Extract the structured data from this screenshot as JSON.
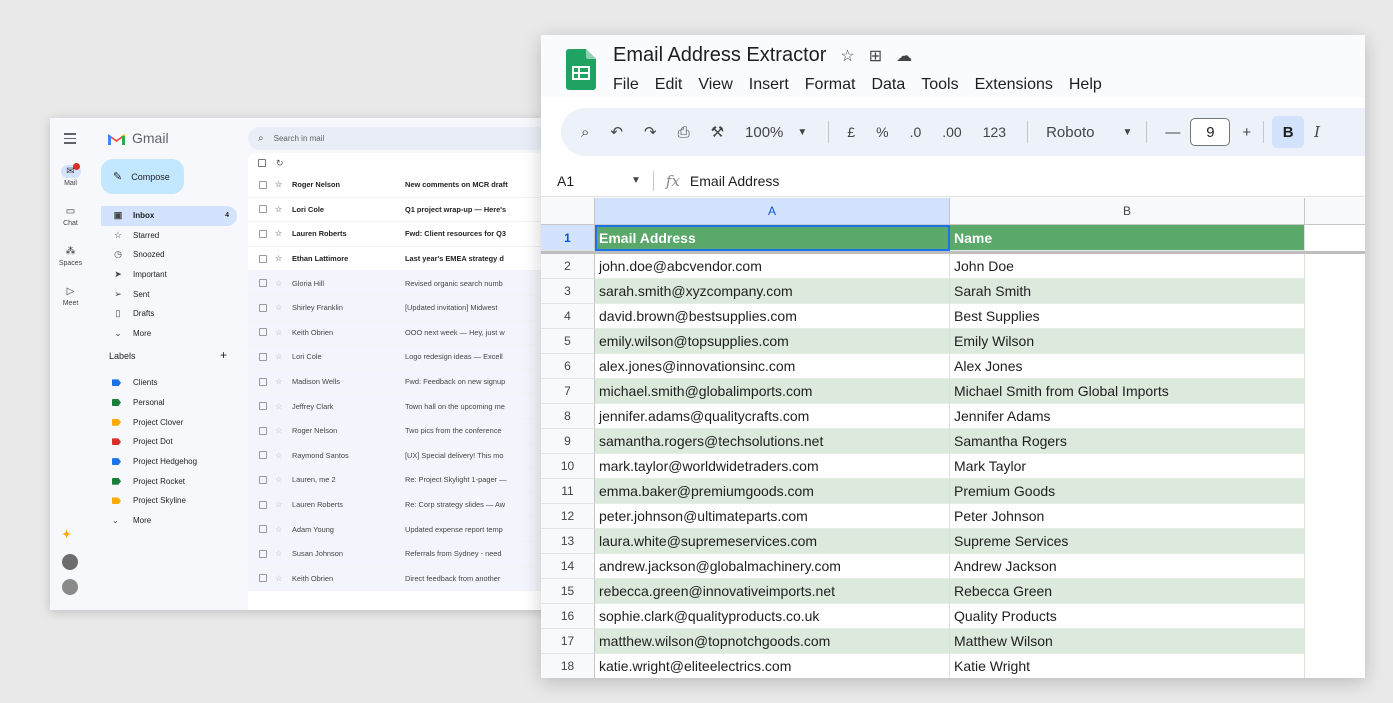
{
  "gmail": {
    "app_name": "Gmail",
    "search_placeholder": "Search in mail",
    "compose_label": "Compose",
    "rail": [
      {
        "label": "Mail",
        "icon": "mail-icon"
      },
      {
        "label": "Chat",
        "icon": "chat-icon"
      },
      {
        "label": "Spaces",
        "icon": "spaces-icon"
      },
      {
        "label": "Meet",
        "icon": "meet-icon"
      }
    ],
    "nav": [
      {
        "label": "Inbox",
        "icon": "inbox-icon",
        "count": "4",
        "active": true
      },
      {
        "label": "Starred",
        "icon": "star-icon"
      },
      {
        "label": "Snoozed",
        "icon": "clock-icon"
      },
      {
        "label": "Important",
        "icon": "important-icon"
      },
      {
        "label": "Sent",
        "icon": "send-icon"
      },
      {
        "label": "Drafts",
        "icon": "draft-icon"
      },
      {
        "label": "More",
        "icon": "chevron-down-icon"
      }
    ],
    "labels_title": "Labels",
    "labels": [
      {
        "label": "Clients",
        "color": "#1a73e8"
      },
      {
        "label": "Personal",
        "color": "#188038"
      },
      {
        "label": "Project Clover",
        "color": "#f9ab00"
      },
      {
        "label": "Project Dot",
        "color": "#d93025"
      },
      {
        "label": "Project Hedgehog",
        "color": "#1a73e8"
      },
      {
        "label": "Project Rocket",
        "color": "#188038"
      },
      {
        "label": "Project Skyline",
        "color": "#f9ab00"
      }
    ],
    "labels_more": "More",
    "emails": [
      {
        "sender": "Roger Nelson",
        "subject": "New comments on MCR draft",
        "unread": true
      },
      {
        "sender": "Lori Cole",
        "subject": "Q1 project wrap-up — Here's",
        "unread": true
      },
      {
        "sender": "Lauren Roberts",
        "subject": "Fwd: Client resources for Q3",
        "unread": true
      },
      {
        "sender": "Ethan Lattimore",
        "subject": "Last year's EMEA strategy d",
        "unread": true
      },
      {
        "sender": "Gloria Hill",
        "subject": "Revised organic search numb",
        "unread": false
      },
      {
        "sender": "Shirley Franklin",
        "subject": "[Updated invitation] Midwest",
        "unread": false
      },
      {
        "sender": "Keith Obrien",
        "subject": "OOO next week — Hey, just w",
        "unread": false
      },
      {
        "sender": "Lori Cole",
        "subject": "Logo redesign ideas — Excell",
        "unread": false
      },
      {
        "sender": "Madison Wells",
        "subject": "Fwd: Feedback on new signup",
        "unread": false
      },
      {
        "sender": "Jeffrey Clark",
        "subject": "Town hall on the upcoming me",
        "unread": false
      },
      {
        "sender": "Roger Nelson",
        "subject": "Two pics from the conference",
        "unread": false
      },
      {
        "sender": "Raymond Santos",
        "subject": "[UX] Special delivery! This mo",
        "unread": false
      },
      {
        "sender": "Lauren, me 2",
        "subject": "Re: Project Skylight 1-pager —",
        "unread": false
      },
      {
        "sender": "Lauren Roberts",
        "subject": "Re: Corp strategy slides — Aw",
        "unread": false
      },
      {
        "sender": "Adam Young",
        "subject": "Updated expense report temp",
        "unread": false
      },
      {
        "sender": "Susan Johnson",
        "subject": "Referrals from Sydney - need",
        "unread": false
      },
      {
        "sender": "Keith Obrien",
        "subject": "Direct feedback from another",
        "unread": false
      }
    ]
  },
  "sheets": {
    "title": "Email Address Extractor",
    "menu": [
      "File",
      "Edit",
      "View",
      "Insert",
      "Format",
      "Data",
      "Tools",
      "Extensions",
      "Help"
    ],
    "toolbar": {
      "zoom": "100%",
      "currency": "£",
      "percent": "%",
      "dec_decrease": ".0",
      "dec_increase": ".00",
      "number_format": "123",
      "font": "Roboto",
      "minus": "—",
      "font_size": "9",
      "plus": "+",
      "bold": "B",
      "italic": "I"
    },
    "cell_ref": "A1",
    "fx": "fx",
    "formula": "Email Address",
    "columns": [
      "A",
      "B"
    ],
    "header_row": {
      "num": "1",
      "a": "Email Address",
      "b": "Name"
    },
    "rows": [
      {
        "num": "2",
        "a": "john.doe@abcvendor.com",
        "b": "John Doe"
      },
      {
        "num": "3",
        "a": "sarah.smith@xyzcompany.com",
        "b": "Sarah Smith"
      },
      {
        "num": "4",
        "a": "david.brown@bestsupplies.com",
        "b": "Best Supplies"
      },
      {
        "num": "5",
        "a": "emily.wilson@topsupplies.com",
        "b": "Emily Wilson"
      },
      {
        "num": "6",
        "a": "alex.jones@innovationsinc.com",
        "b": "Alex Jones"
      },
      {
        "num": "7",
        "a": "michael.smith@globalimports.com",
        "b": "Michael Smith from Global Imports"
      },
      {
        "num": "8",
        "a": "jennifer.adams@qualitycrafts.com",
        "b": "Jennifer Adams"
      },
      {
        "num": "9",
        "a": "samantha.rogers@techsolutions.net",
        "b": "Samantha Rogers"
      },
      {
        "num": "10",
        "a": "mark.taylor@worldwidetraders.com",
        "b": "Mark Taylor"
      },
      {
        "num": "11",
        "a": "emma.baker@premiumgoods.com",
        "b": "Premium Goods"
      },
      {
        "num": "12",
        "a": "peter.johnson@ultimateparts.com",
        "b": "Peter Johnson"
      },
      {
        "num": "13",
        "a": "laura.white@supremeservices.com",
        "b": "Supreme Services"
      },
      {
        "num": "14",
        "a": "andrew.jackson@globalmachinery.com",
        "b": "Andrew Jackson"
      },
      {
        "num": "15",
        "a": "rebecca.green@innovativeimports.net",
        "b": "Rebecca Green"
      },
      {
        "num": "16",
        "a": "sophie.clark@qualityproducts.co.uk",
        "b": "Quality Products"
      },
      {
        "num": "17",
        "a": "matthew.wilson@topnotchgoods.com",
        "b": "Matthew Wilson"
      },
      {
        "num": "18",
        "a": "katie.wright@eliteelectrics.com",
        "b": "Katie Wright"
      }
    ]
  }
}
